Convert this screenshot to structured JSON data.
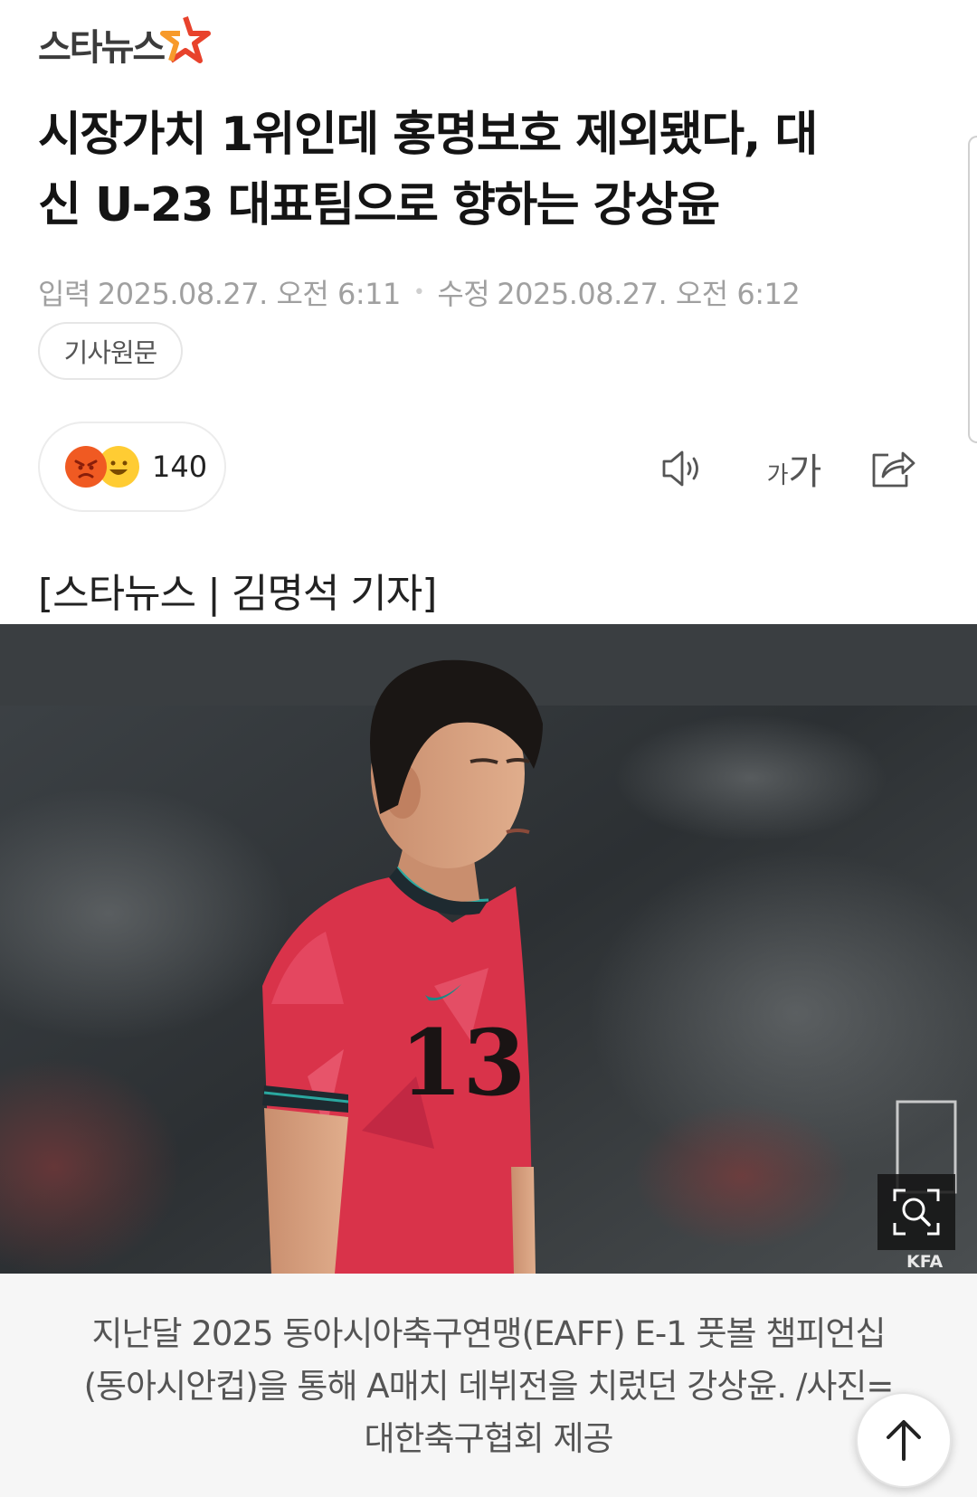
{
  "header": {
    "logo_text": "스타뉴스",
    "logo_icon": "star-logo-icon"
  },
  "article": {
    "headline_line1": "시장가치 1위인데 홍명보호 제외됐다, 대",
    "headline_line2": "신 U-23 대표팀으로 향하는 강상윤",
    "input_label": "입력",
    "input_date": "2025.08.27. 오전 6:11",
    "edit_label": "수정",
    "edit_date": "2025.08.27. 오전 6:12",
    "original_button": "기사원문",
    "reaction_count": "140",
    "byline": "[스타뉴스 | 김명석 기자]",
    "photo_number": "13",
    "photo_credit": "KFA",
    "caption_line1": "지난달 2025 동아시아축구연맹(EAFF) E-1 풋볼 챔피언십",
    "caption_line2": "(동아시안컵)을 통해 A매치 데뷔전을 치렀던 강상윤. /사진=",
    "caption_line3": "대한축구협회 제공"
  },
  "toolbar": {
    "font_size_label": "가가",
    "icons": [
      "speaker-icon",
      "font-size-icon",
      "share-icon"
    ]
  },
  "colors": {
    "logo_star_red": "#e8422c",
    "logo_star_orange": "#f79a2a",
    "angry_emoji": "#f05a22",
    "happy_emoji": "#ffcc33",
    "jersey": "#d9334a",
    "photo_bg": "#2e3235"
  }
}
